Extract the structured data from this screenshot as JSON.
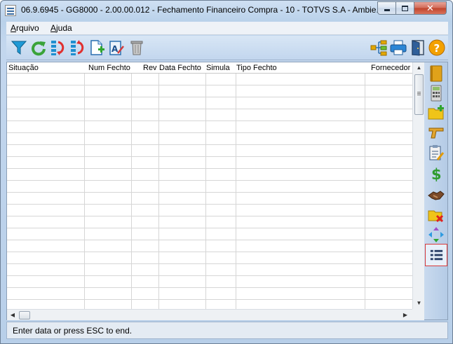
{
  "window": {
    "title": "06.9.6945 - GG8000 - 2.00.00.012 - Fechamento Financeiro Compra - 10 - TOTVS S.A - Ambie..."
  },
  "menu": {
    "arquivo_first": "A",
    "arquivo_rest": "rquivo",
    "ajuda_first": "A",
    "ajuda_rest": "juda"
  },
  "toolbar": {
    "left_icons": [
      "filter-icon",
      "refresh-icon",
      "sort-ascending-icon",
      "sort-descending-icon",
      "new-document-icon",
      "edit-text-icon",
      "trash-icon"
    ],
    "right_icons": [
      "hierarchy-icon",
      "print-icon",
      "exit-door-icon",
      "help-icon"
    ]
  },
  "grid": {
    "columns": [
      "Situação",
      "Num Fechto",
      "Rev",
      "Data Fechto",
      "Simula",
      "Tipo Fechto",
      "Fornecedor"
    ],
    "rows": []
  },
  "sidepanel": {
    "icons": [
      "notebook-icon",
      "calculator-icon",
      "add-folder-icon",
      "pistol-icon",
      "clipboard-edit-icon",
      "dollar-icon",
      "handshake-icon",
      "folder-delete-icon",
      "arrows-merge-icon",
      "list-icon"
    ],
    "selected": "list-icon"
  },
  "status": {
    "message": "Enter data or press ESC to end."
  },
  "colors": {
    "accent": "#3b6ea5",
    "close_button": "#c0432b",
    "selected_border": "#d83a3a"
  }
}
